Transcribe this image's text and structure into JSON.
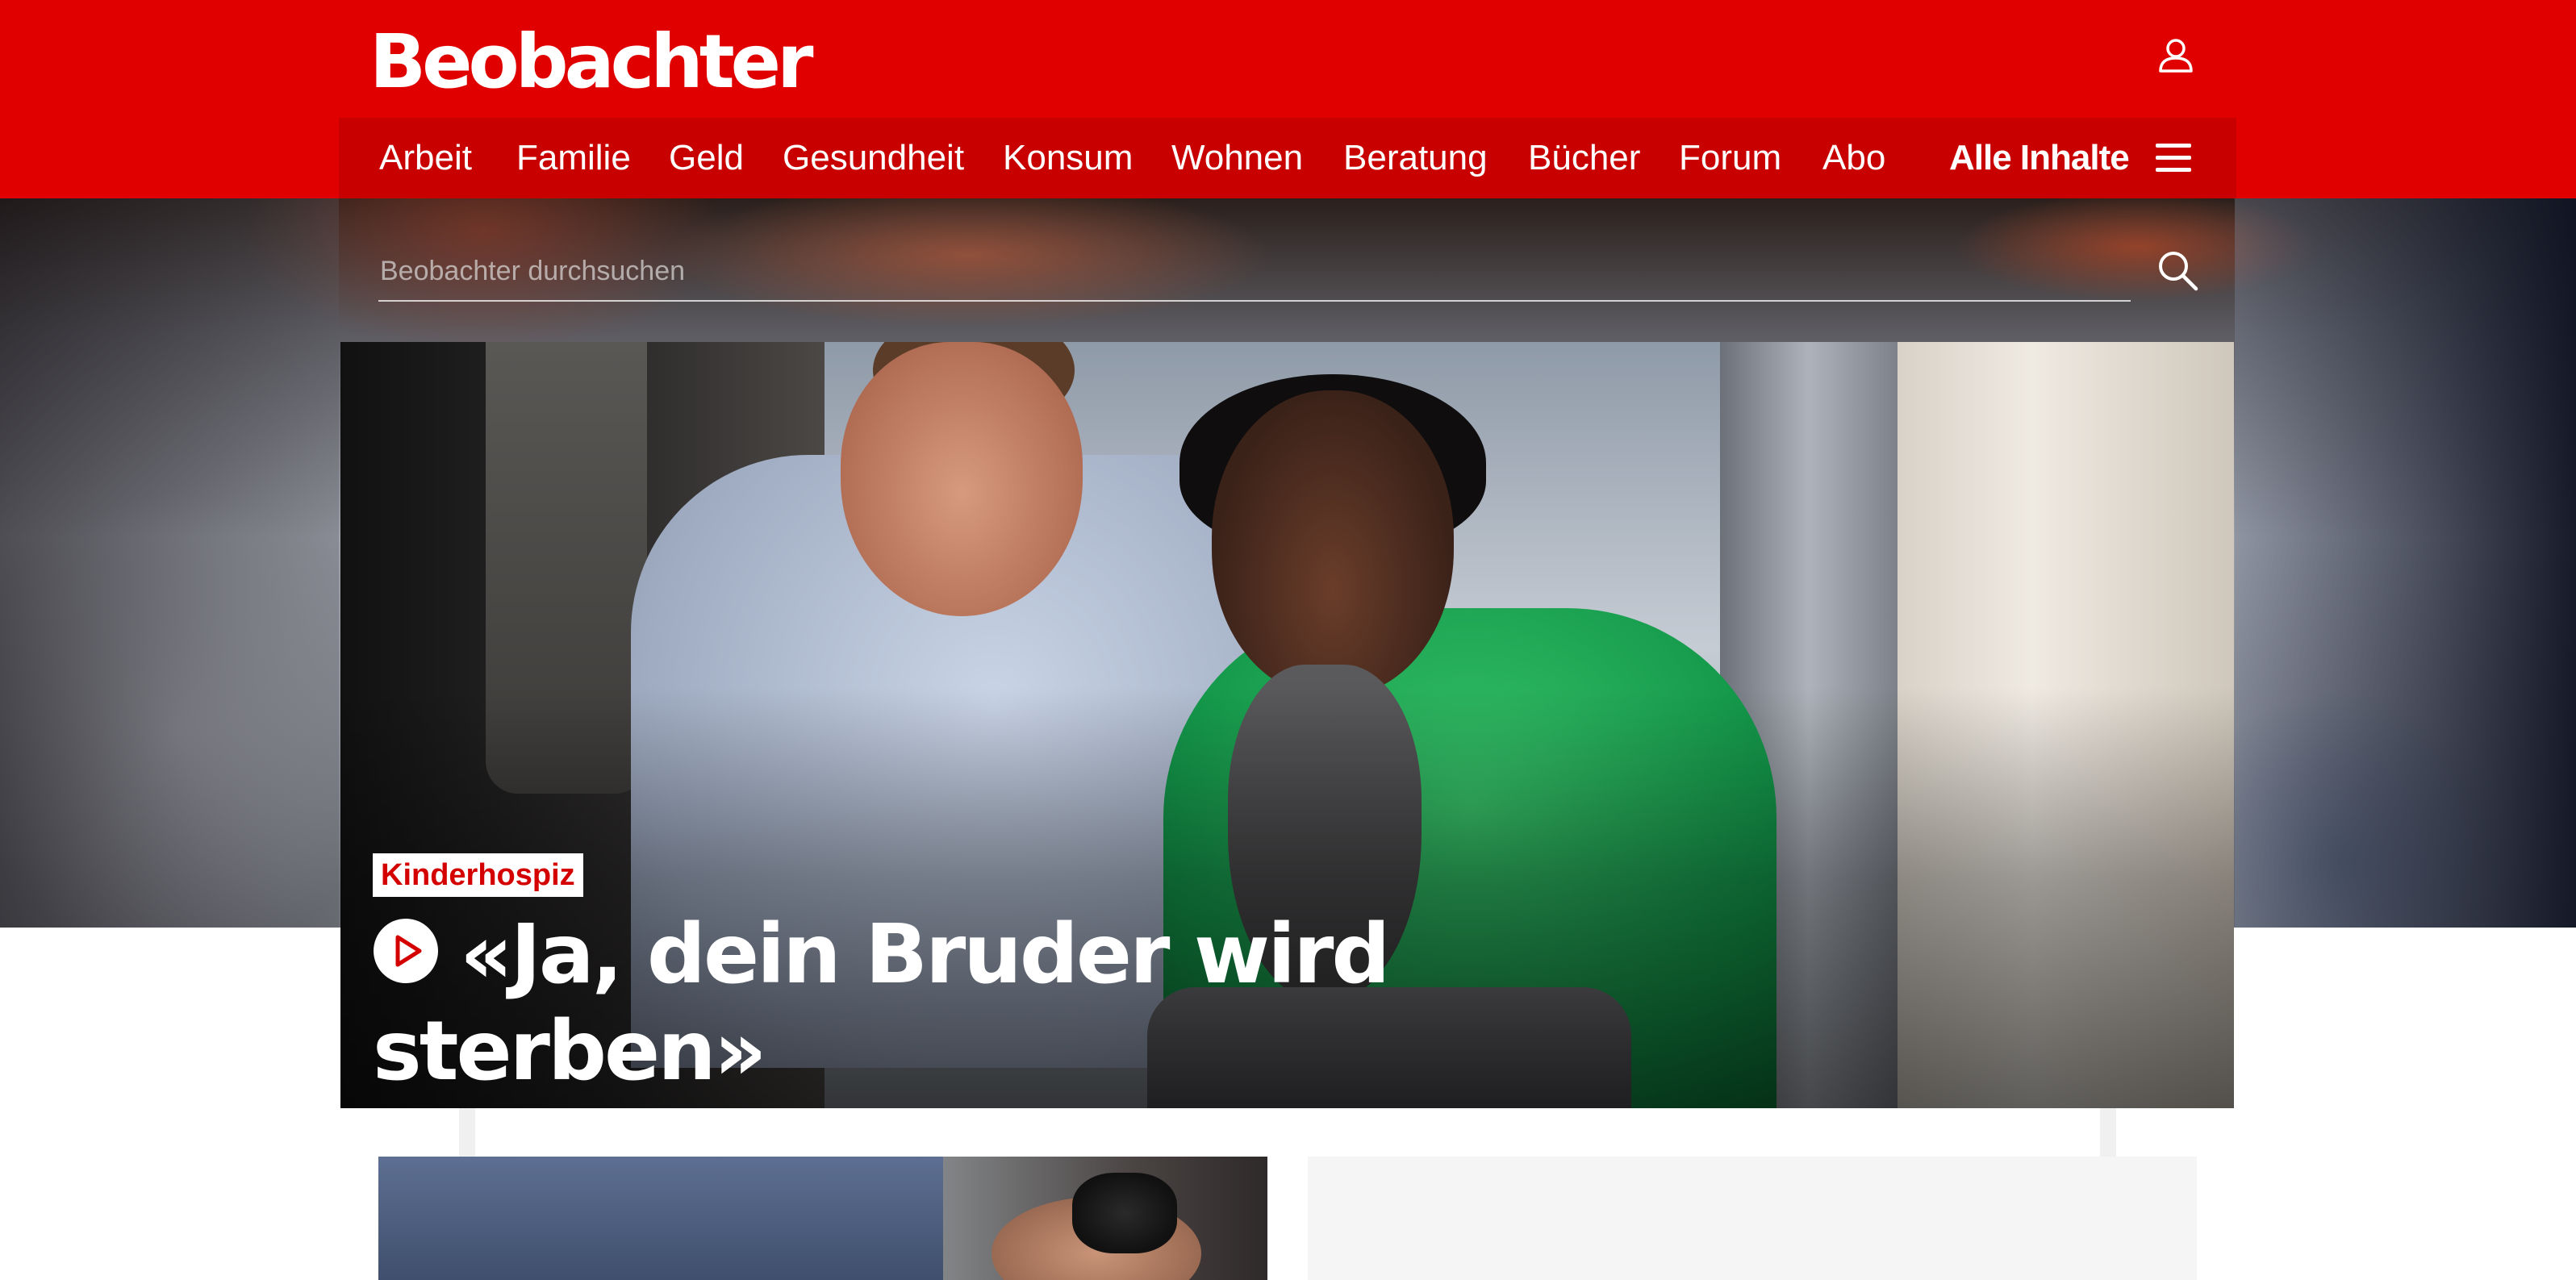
{
  "header": {
    "logo_text": "Beobachter",
    "user_icon": "user-icon"
  },
  "nav": {
    "items": [
      {
        "label": "Arbeit"
      },
      {
        "label": "Familie"
      },
      {
        "label": "Geld"
      },
      {
        "label": "Gesundheit"
      },
      {
        "label": "Konsum"
      },
      {
        "label": "Wohnen"
      },
      {
        "label": "Beratung"
      },
      {
        "label": "Bücher"
      },
      {
        "label": "Forum"
      },
      {
        "label": "Abo"
      }
    ],
    "all_label": "Alle Inhalte",
    "menu_icon": "hamburger-menu-icon"
  },
  "search": {
    "placeholder": "Beobachter durchsuchen",
    "value": "",
    "icon": "search-icon"
  },
  "hero": {
    "kicker": "Kinderhospiz",
    "headline": "«Ja, dein Bruder wird sterben»",
    "play_icon": "play-circle-icon"
  },
  "colors": {
    "brand_red": "#e00000",
    "nav_red": "#c80000",
    "kicker_text": "#d40000"
  }
}
